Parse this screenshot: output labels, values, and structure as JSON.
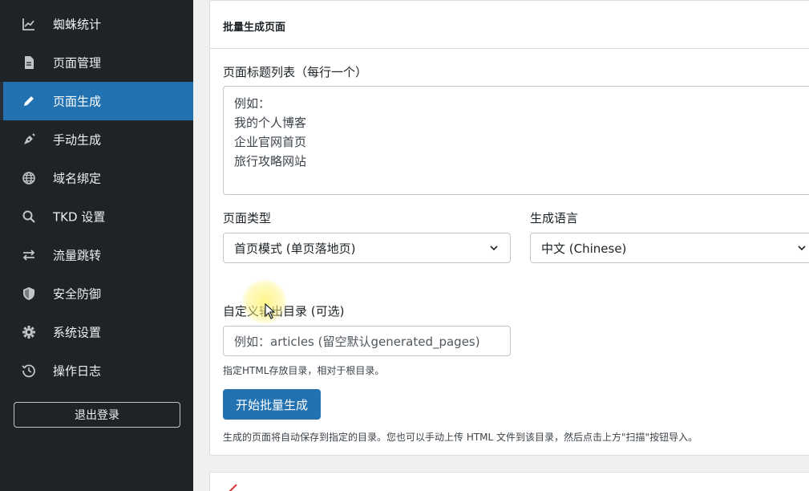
{
  "sidebar": {
    "items": [
      {
        "label": "蜘蛛统计",
        "icon": "line-chart-icon"
      },
      {
        "label": "页面管理",
        "icon": "file-icon"
      },
      {
        "label": "页面生成",
        "icon": "pencil-icon",
        "active": true
      },
      {
        "label": "手动生成",
        "icon": "pen-nib-icon"
      },
      {
        "label": "域名绑定",
        "icon": "globe-icon"
      },
      {
        "label": "TKD 设置",
        "icon": "search-icon"
      },
      {
        "label": "流量跳转",
        "icon": "swap-arrows-icon"
      },
      {
        "label": "安全防御",
        "icon": "shield-icon"
      },
      {
        "label": "系统设置",
        "icon": "gear-icon"
      },
      {
        "label": "操作日志",
        "icon": "history-icon"
      }
    ],
    "logout_label": "退出登录"
  },
  "main": {
    "card_title": "批量生成页面",
    "titles_label": "页面标题列表（每行一个）",
    "titles_placeholder": "例如：\n我的个人博客\n企业官网首页\n旅行攻略网站",
    "page_type_label": "页面类型",
    "page_type_value": "首页模式 (单页落地页)",
    "language_label": "生成语言",
    "language_value": "中文 (Chinese)",
    "output_dir_label": "自定义输出目录 (可选)",
    "output_dir_placeholder": "例如：articles (留空默认generated_pages)",
    "output_dir_hint": "指定HTML存放目录，相对于根目录。",
    "submit_label": "开始批量生成",
    "footer_note": "生成的页面将自动保存到指定的目录。您也可以手动上传 HTML 文件到该目录，然后点击上方\"扫描\"按钮导入。"
  },
  "colors": {
    "sidebar_bg": "#1d2327",
    "accent": "#2271b1"
  }
}
